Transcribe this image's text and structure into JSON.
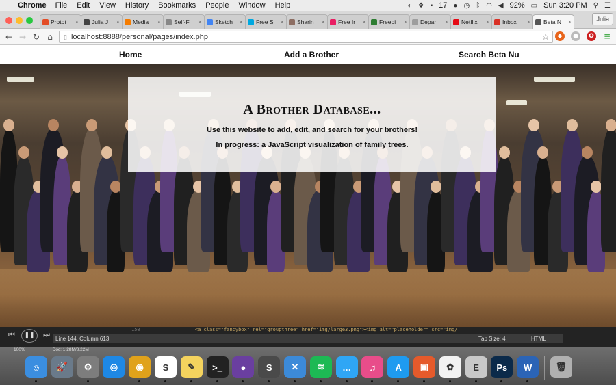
{
  "menubar": {
    "app_name": "Chrome",
    "items": [
      "File",
      "Edit",
      "View",
      "History",
      "Bookmarks",
      "People",
      "Window",
      "Help"
    ],
    "status": {
      "notifications": "17",
      "battery": "92%",
      "clock": "Sun 3:20 PM"
    }
  },
  "tabs": [
    {
      "label": "Protot",
      "color": "#e34c26"
    },
    {
      "label": "Julia J",
      "color": "#444444"
    },
    {
      "label": "Media",
      "color": "#f57c00"
    },
    {
      "label": "Self-F",
      "color": "#888888"
    },
    {
      "label": "Sketch",
      "color": "#4285f4"
    },
    {
      "label": "Free S",
      "color": "#00a8e0"
    },
    {
      "label": "Sharin",
      "color": "#8d6e63"
    },
    {
      "label": "Free Ir",
      "color": "#e91e63"
    },
    {
      "label": "Freepi",
      "color": "#2e7d32"
    },
    {
      "label": "Depar",
      "color": "#9e9e9e"
    },
    {
      "label": "Netflix",
      "color": "#e50914"
    },
    {
      "label": "Inbox",
      "color": "#d93025"
    },
    {
      "label": "Beta N",
      "color": "#555555"
    }
  ],
  "active_tab_index": 12,
  "profile_name": "Julia",
  "url": "localhost:8888/personal/pages/index.php",
  "site_nav": {
    "home": "Home",
    "add": "Add a Brother",
    "search": "Search Beta Nu"
  },
  "intro": {
    "title": "A Brother Database...",
    "line1": "Use this website to add, edit, and search for your brothers!",
    "line2": "In progress: a JavaScript visualization of family trees."
  },
  "editor": {
    "line_number": "150",
    "code": "<a class=\"fancybox\" rel=\"groupthree\" href=\"img/large3.png\"><img alt=\"placeholder\" src=\"img/",
    "cursor": "Line 144, Column 613",
    "tab_size": "Tab Size: 4",
    "language": "HTML",
    "zoom": "100%",
    "doc": "Doc: 1.28M/8.22M"
  },
  "dock": [
    {
      "name": "finder",
      "glyph": "☺",
      "color": "#3b8ee0"
    },
    {
      "name": "launchpad",
      "glyph": "🚀",
      "color": "#6a7a8a"
    },
    {
      "name": "system-preferences",
      "glyph": "⚙",
      "color": "#7d7d7d"
    },
    {
      "name": "safari",
      "glyph": "◎",
      "color": "#1e88e5"
    },
    {
      "name": "chrome",
      "glyph": "◉",
      "color": "#e0a21b"
    },
    {
      "name": "slack",
      "glyph": "S",
      "color": "#ffffff"
    },
    {
      "name": "stickies",
      "glyph": "✎",
      "color": "#f4d35e"
    },
    {
      "name": "terminal",
      "glyph": ">_",
      "color": "#222222"
    },
    {
      "name": "github",
      "glyph": "●",
      "color": "#6a3fa0"
    },
    {
      "name": "sublime-text",
      "glyph": "S",
      "color": "#4a4a4a"
    },
    {
      "name": "xcode",
      "glyph": "✕",
      "color": "#3c8ad8"
    },
    {
      "name": "spotify",
      "glyph": "≋",
      "color": "#1db954"
    },
    {
      "name": "messages",
      "glyph": "…",
      "color": "#2fa6f5"
    },
    {
      "name": "itunes",
      "glyph": "♫",
      "color": "#e84d8a"
    },
    {
      "name": "app-store",
      "glyph": "A",
      "color": "#1e9bf0"
    },
    {
      "name": "presentation",
      "glyph": "▣",
      "color": "#e55a2b"
    },
    {
      "name": "photos",
      "glyph": "✿",
      "color": "#f2f2f2"
    },
    {
      "name": "evernote",
      "glyph": "E",
      "color": "#c8c8c8"
    },
    {
      "name": "photoshop",
      "glyph": "Ps",
      "color": "#0b2a4a"
    },
    {
      "name": "word",
      "glyph": "W",
      "color": "#2b64b6"
    },
    {
      "name": "trash",
      "glyph": "🗑",
      "color": "#b0b0b0"
    }
  ]
}
